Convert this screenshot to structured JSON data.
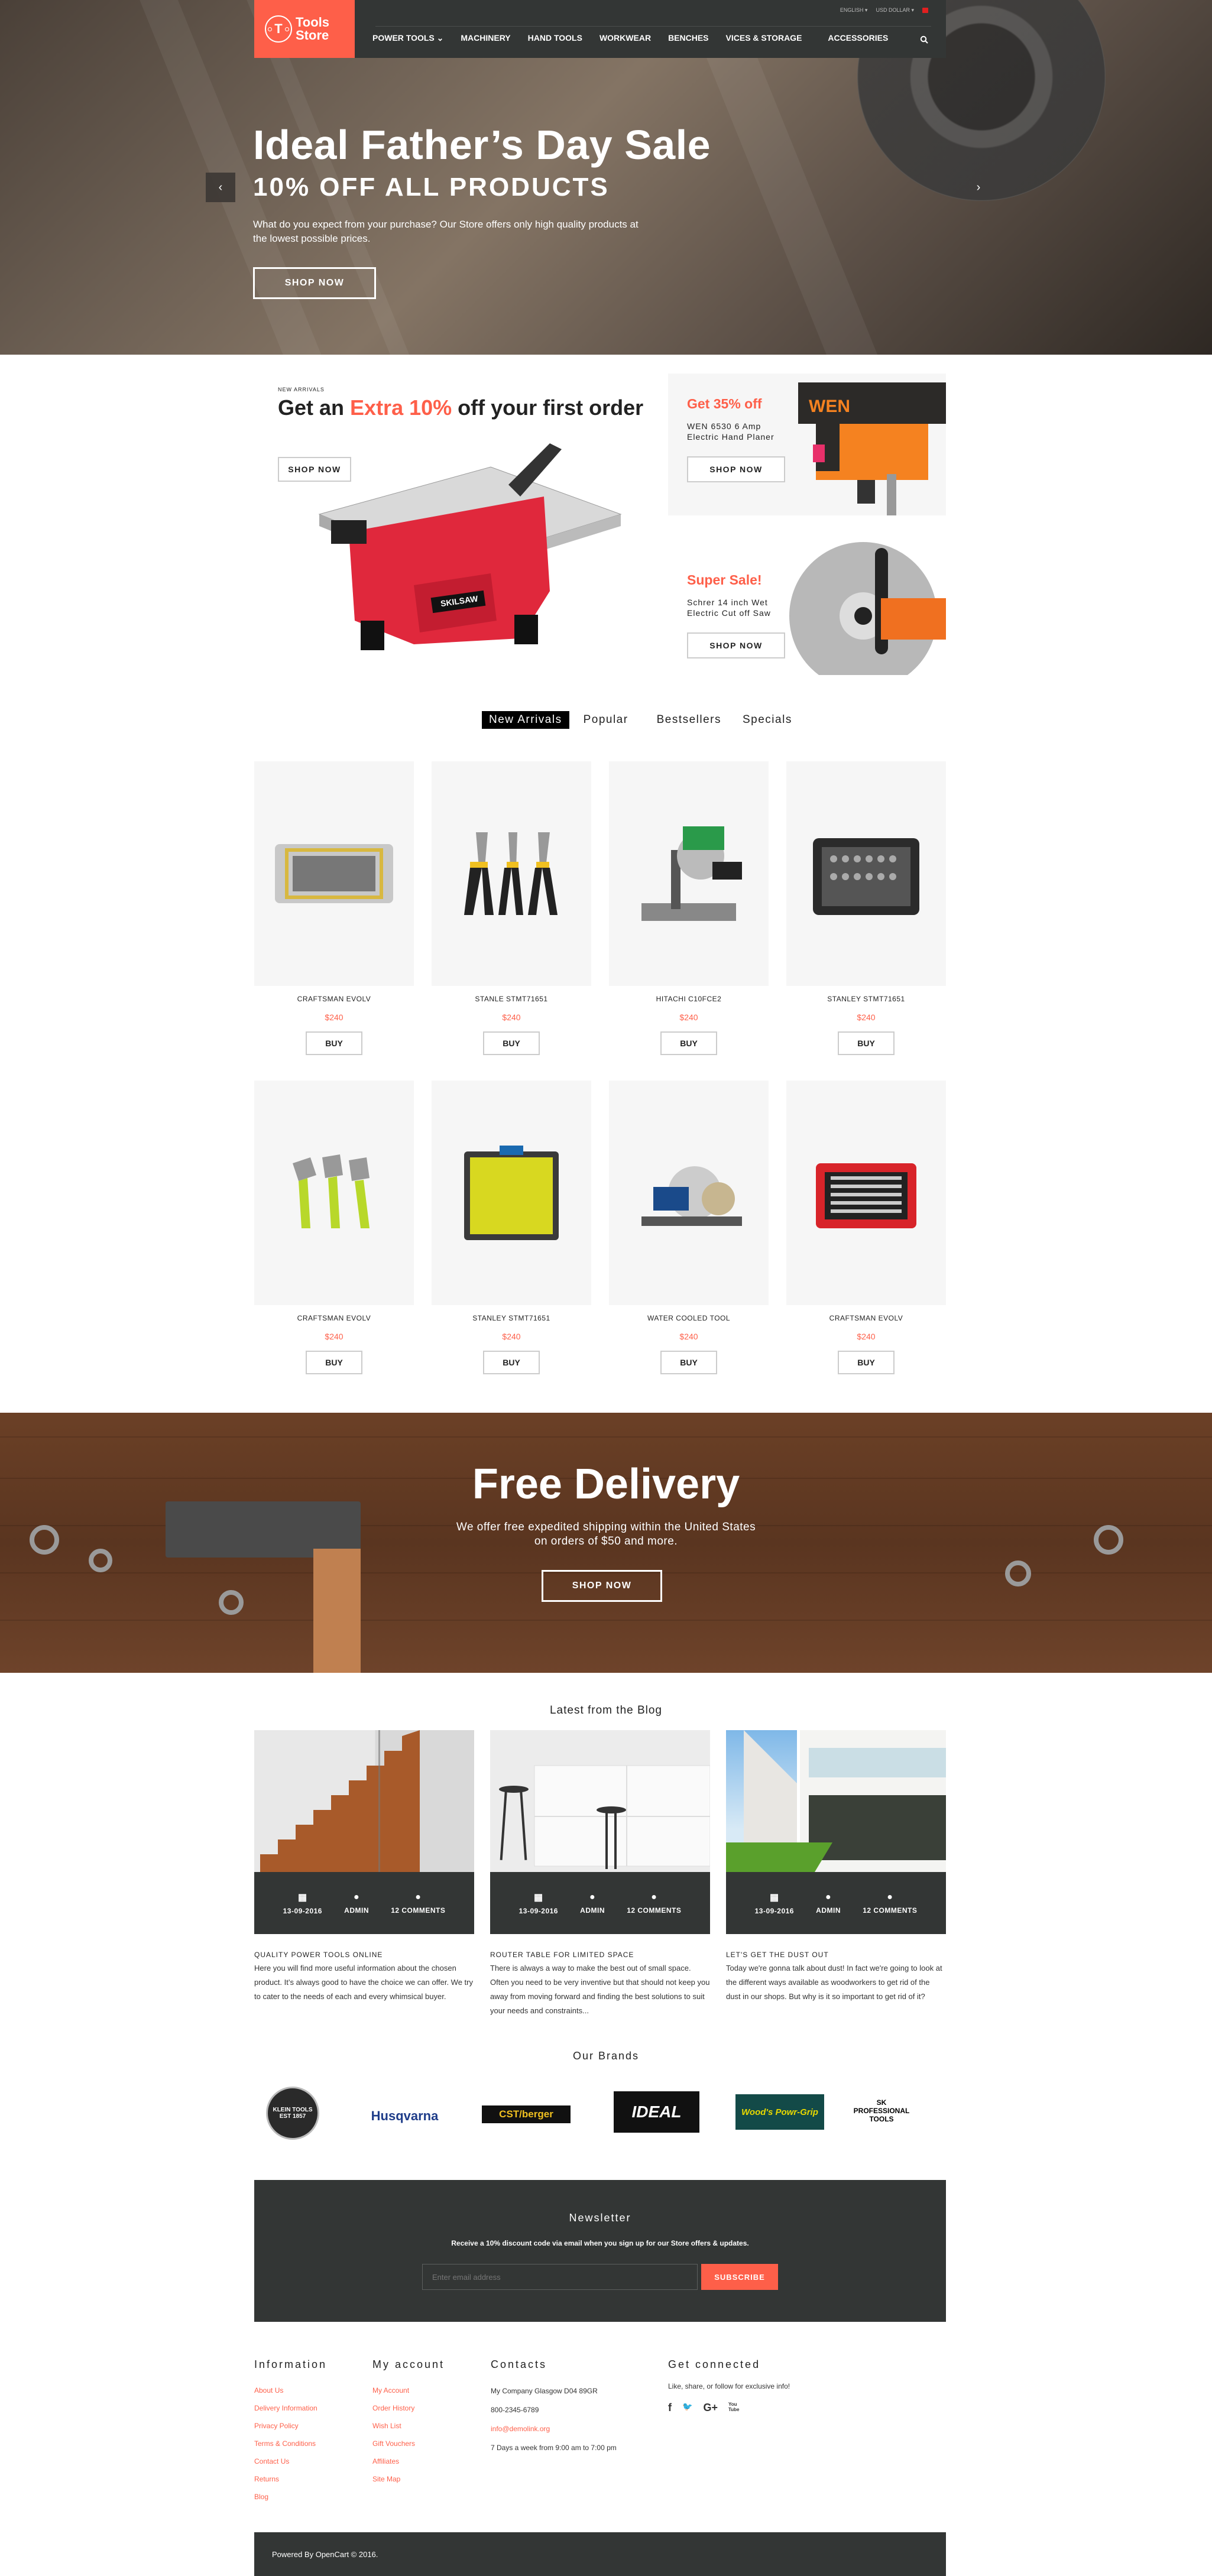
{
  "header": {
    "logo_text_line1": "Tools",
    "logo_text_line2": "Store",
    "logo_mark": "T",
    "language": "ENGLISH ▾",
    "currency": "USD DOLLAR ▾",
    "nav": [
      "POWER TOOLS ⌄",
      "MACHINERY",
      "HAND TOOLS",
      "WORKWEAR",
      "BENCHES",
      "VICES & STORAGE",
      "ACCESSORIES"
    ],
    "icons": {
      "cart": "cart-icon",
      "search": "search-icon"
    }
  },
  "hero": {
    "title": "Ideal Father’s Day Sale",
    "subtitle": "10% OFF ALL PRODUCTS",
    "text": "What do you expect from your purchase? Our Store offers only high quality products at the lowest possible prices.",
    "button": "SHOP NOW",
    "prev": "‹",
    "next": "›"
  },
  "promo": {
    "main": {
      "label": "NEW ARRIVALS",
      "title_pre": "Get an ",
      "title_accent": "Extra 10%",
      "title_post": " off your first order",
      "button": "SHOP NOW",
      "product_brand": "SKILSAW"
    },
    "side": [
      {
        "title": "Get 35% off",
        "desc": "WEN 6530 6 Amp Electric Hand Planer",
        "button": "SHOP NOW",
        "product_brand": "WEN"
      },
      {
        "title": "Super Sale!",
        "desc": "Schrer 14 inch Wet Electric Cut off Saw",
        "button": "SHOP NOW"
      }
    ]
  },
  "tabs": [
    {
      "label": "New Arrivals",
      "active": true
    },
    {
      "label": "Popular",
      "active": false
    },
    {
      "label": "Bestsellers",
      "active": false
    },
    {
      "label": "Specials",
      "active": false
    }
  ],
  "products": [
    {
      "name": "CRAFTSMAN EVOLV",
      "price": "$240",
      "buy": "BUY"
    },
    {
      "name": "STANLE  STMT71651",
      "price": "$240",
      "buy": "BUY"
    },
    {
      "name": "HITACHI C10FCE2",
      "price": "$240",
      "buy": "BUY"
    },
    {
      "name": "STANLEY STMT71651",
      "price": "$240",
      "buy": "BUY"
    },
    {
      "name": "CRAFTSMAN EVOLV",
      "price": "$240",
      "buy": "BUY"
    },
    {
      "name": "STANLEY STMT71651",
      "price": "$240",
      "buy": "BUY"
    },
    {
      "name": "WATER COOLED TOOL",
      "price": "$240",
      "buy": "BUY"
    },
    {
      "name": "CRAFTSMAN EVOLV",
      "price": "$240",
      "buy": "BUY"
    }
  ],
  "delivery": {
    "title": "Free Delivery",
    "line1": "We offer free expedited shipping within the United States",
    "line2": "on orders of $50 and more.",
    "button": "SHOP NOW"
  },
  "blog": {
    "title": "Latest from the Blog",
    "posts": [
      {
        "date": "13-09-2016",
        "author": "ADMIN",
        "comments": "12 COMMENTS",
        "title": "QUALITY POWER TOOLS ONLINE",
        "text": "Here you will find more useful information about the chosen product. It’s always good to have the choice we can offer. We try to cater to the needs of each and every whimsical buyer."
      },
      {
        "date": "13-09-2016",
        "author": "ADMIN",
        "comments": "12 COMMENTS",
        "title": "ROUTER TABLE FOR LIMITED SPACE",
        "text": "There is always a way to make the best out of small space. Often you need to be very inventive but that should not keep you away from moving forward and finding the best solutions to suit your needs and constraints..."
      },
      {
        "date": "13-09-2016",
        "author": "ADMIN",
        "comments": "12 COMMENTS",
        "title": "LET'S GET THE DUST OUT",
        "text": "Today we're gonna talk about dust! In fact we're going to look at the different ways available as woodworkers to get rid of the dust in our shops. But why is it so important to get rid of it?"
      }
    ]
  },
  "brands": {
    "title": "Our Brands",
    "items": [
      "KLEIN TOOLS EST 1857",
      "Husqvarna",
      "CST/berger",
      "IDEAL",
      "Wood's Powr-Grip",
      "SK PROFESSIONAL TOOLS"
    ]
  },
  "newsletter": {
    "title": "Newsletter",
    "text": "Receive a 10% discount code via email when you sign up for our Store offers & updates.",
    "placeholder": "Enter email address",
    "button": "SUBSCRIBE"
  },
  "footer": {
    "information": {
      "title": "Information",
      "links": [
        "About Us",
        "Delivery Information",
        "Privacy Policy",
        "Terms & Conditions",
        "Contact Us",
        "Returns",
        "Blog"
      ]
    },
    "account": {
      "title": "My account",
      "links": [
        "My Account",
        "Order History",
        "Wish List",
        "Gift Vouchers",
        "Affiliates",
        "Site Map"
      ]
    },
    "contacts": {
      "title": "Contacts",
      "address": "My Company Glasgow D04 89GR",
      "phone": "800-2345-6789",
      "email": "info@demolink.org",
      "hours": "7 Days a week from 9:00 am to 7:00 pm"
    },
    "connected": {
      "title": "Get connected",
      "text": "Like, share, or follow for exclusive info!",
      "social": [
        "f",
        "🐦",
        "G+",
        "You Tube"
      ]
    },
    "copyright": "Powered By OpenCart © 2016."
  },
  "colors": {
    "accent": "#fe5f49",
    "dark": "#333635",
    "product_bg": "#f6f6f6"
  }
}
